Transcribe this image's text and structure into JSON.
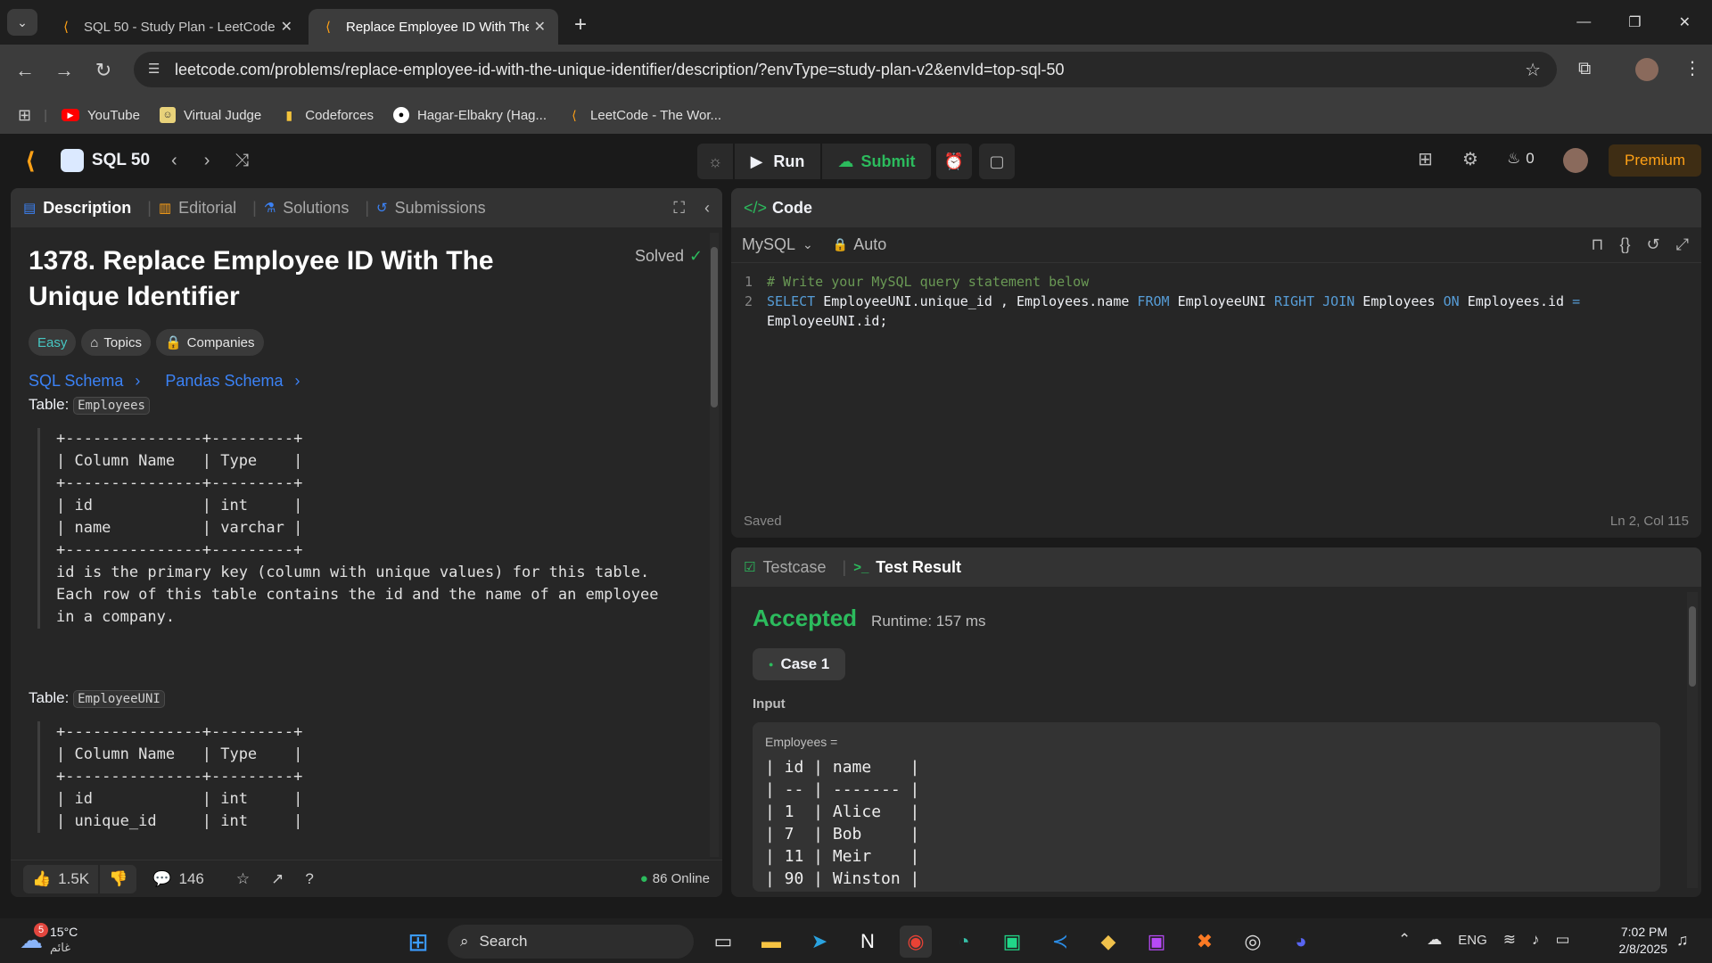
{
  "browser": {
    "tabs": [
      {
        "title": "SQL 50 - Study Plan - LeetCode",
        "active": false
      },
      {
        "title": "Replace Employee ID With The",
        "active": true
      }
    ],
    "url": "leetcode.com/problems/replace-employee-id-with-the-unique-identifier/description/?envType=study-plan-v2&envId=top-sql-50",
    "bookmarks": [
      "YouTube",
      "Virtual Judge",
      "Codeforces",
      "Hagar-Elbakry (Hag...",
      "LeetCode - The Wor..."
    ]
  },
  "lcnav": {
    "study_plan": "SQL 50",
    "run": "Run",
    "submit": "Submit",
    "streak": "0",
    "premium": "Premium"
  },
  "description": {
    "tabs": [
      "Description",
      "Editorial",
      "Solutions",
      "Submissions"
    ],
    "title": "1378. Replace Employee ID With The Unique Identifier",
    "solved": "Solved",
    "chips": [
      "Easy",
      "Topics",
      "Companies"
    ],
    "schema_links": [
      "SQL Schema",
      "Pandas Schema"
    ],
    "table_label": "Table:",
    "table1_name": "Employees",
    "table1_text": "+---------------+---------+\n| Column Name   | Type    |\n+---------------+---------+\n| id            | int     |\n| name          | varchar |\n+---------------+---------+\nid is the primary key (column with unique values) for this table.\nEach row of this table contains the id and the name of an employee\nin a company.",
    "table2_name": "EmployeeUNI",
    "table2_text": "+---------------+---------+\n| Column Name   | Type    |\n+---------------+---------+\n| id            | int     |\n| unique_id     | int     |",
    "likes": "1.5K",
    "comments": "146",
    "online": "86 Online"
  },
  "code": {
    "header": "Code",
    "language": "MySQL",
    "mode": "Auto",
    "line1": "# Write your MySQL query statement below",
    "line2": {
      "p1": "SELECT",
      "p2": " EmployeeUNI.unique_id , Employees.name ",
      "p3": "FROM",
      "p4": " EmployeeUNI ",
      "p5": "RIGHT JOIN",
      "p6": " Employees ",
      "p7": "ON",
      "p8": " Employees.id ",
      "p9": "=",
      "wrap": "EmployeeUNI.id;"
    },
    "saved": "Saved",
    "position": "Ln 2, Col 115"
  },
  "result": {
    "tabs": [
      "Testcase",
      "Test Result"
    ],
    "status": "Accepted",
    "runtime": "Runtime: 157 ms",
    "case": "Case 1",
    "input_label": "Input",
    "var_label": "Employees =",
    "table_text": "| id | name    |\n| -- | ------- |\n| 1  | Alice   |\n| 7  | Bob     |\n| 11 | Meir    |\n| 90 | Winston |"
  },
  "taskbar": {
    "temp": "15°C",
    "weather_text": "غائم",
    "weather_badge": "5",
    "search": "Search",
    "lang": "ENG",
    "time": "7:02 PM",
    "date": "2/8/2025"
  },
  "colors": {
    "accent": "#ffa116",
    "accepted": "#2cbb5d",
    "link": "#3b82f6",
    "easy": "#46c6c2"
  }
}
